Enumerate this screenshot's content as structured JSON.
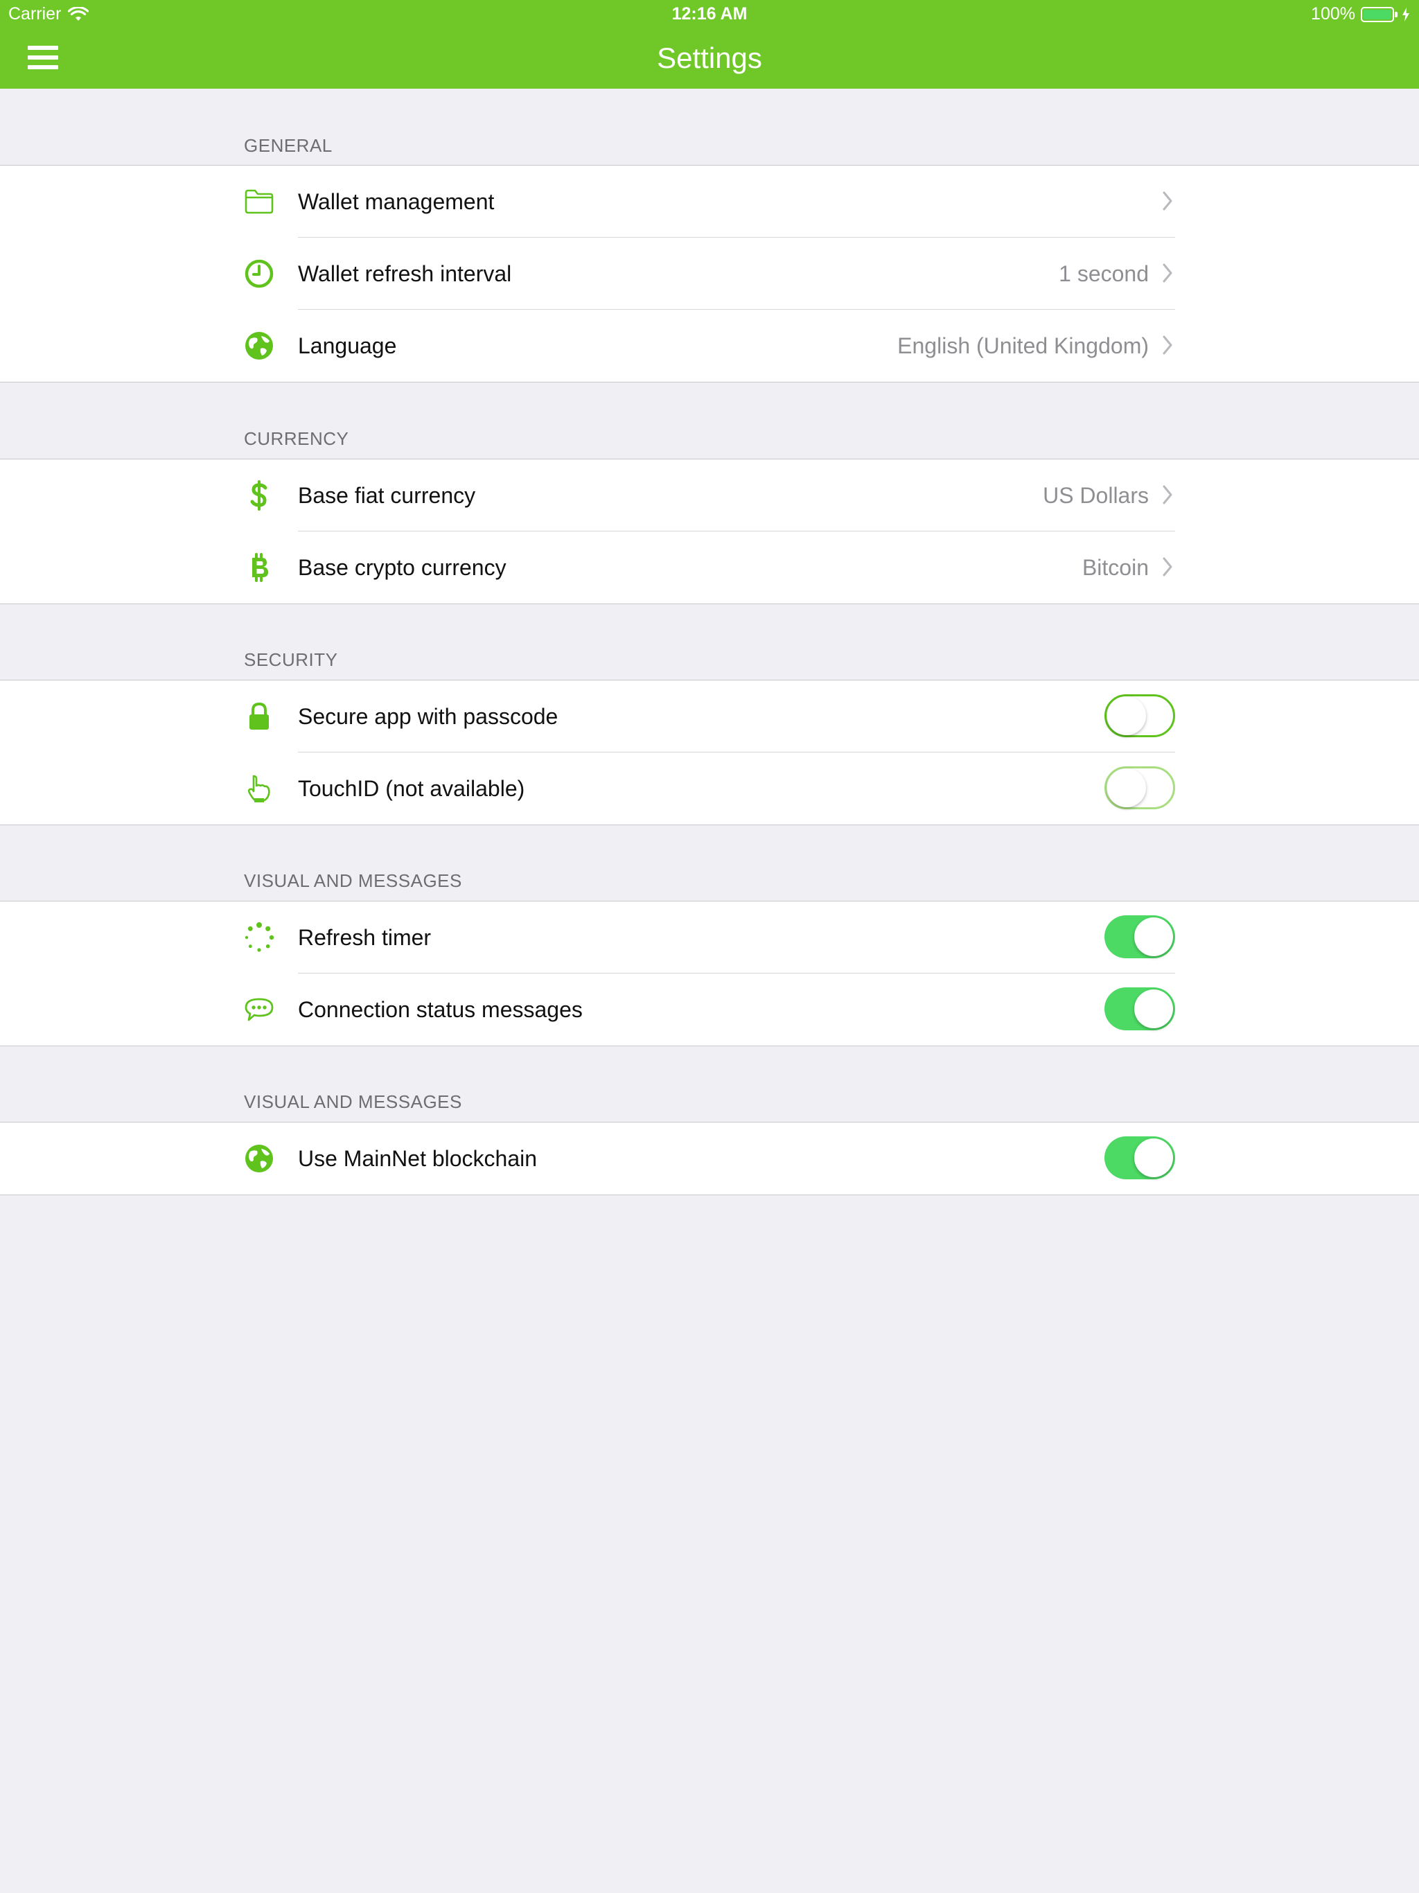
{
  "status_bar": {
    "carrier": "Carrier",
    "time": "12:16 AM",
    "battery": "100%",
    "battery_level": 1.0
  },
  "nav": {
    "title": "Settings"
  },
  "colors": {
    "accent": "#6fc828",
    "toggle_on": "#4cd964",
    "value_text": "#8e8e93"
  },
  "sections": {
    "general": {
      "header": "GENERAL",
      "rows": [
        {
          "label": "Wallet management",
          "value": "",
          "icon": "folder-icon"
        },
        {
          "label": "Wallet refresh interval",
          "value": "1 second",
          "icon": "clock-icon"
        },
        {
          "label": "Language",
          "value": "English (United Kingdom)",
          "icon": "globe-icon"
        }
      ]
    },
    "currency": {
      "header": "CURRENCY",
      "rows": [
        {
          "label": "Base fiat currency",
          "value": "US Dollars",
          "icon": "dollar-icon"
        },
        {
          "label": "Base crypto currency",
          "value": "Bitcoin",
          "icon": "bitcoin-icon"
        }
      ]
    },
    "security": {
      "header": "SECURITY",
      "rows": [
        {
          "label": "Secure app with passcode",
          "toggle": false,
          "enabled": true,
          "icon": "lock-icon"
        },
        {
          "label": "TouchID (not available)",
          "toggle": false,
          "enabled": false,
          "icon": "hand-pointer-icon"
        }
      ]
    },
    "visual": {
      "header": "VISUAL AND MESSAGES",
      "rows": [
        {
          "label": "Refresh timer",
          "toggle": true,
          "icon": "spinner-icon"
        },
        {
          "label": "Connection status messages",
          "toggle": true,
          "icon": "chat-bubble-icon"
        }
      ]
    },
    "network": {
      "header": "VISUAL AND MESSAGES",
      "rows": [
        {
          "label": "Use MainNet blockchain",
          "toggle": true,
          "icon": "globe-icon"
        }
      ]
    }
  }
}
